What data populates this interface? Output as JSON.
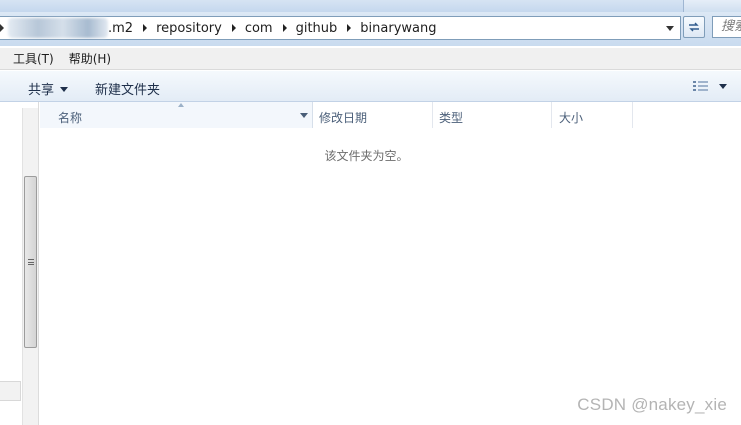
{
  "address_bar": {
    "crumbs": [
      ".m2",
      "repository",
      "com",
      "github",
      "binarywang"
    ]
  },
  "search": {
    "placeholder": "搜索"
  },
  "menu": {
    "items": [
      "工具(T)",
      "帮助(H)"
    ]
  },
  "toolbar": {
    "share_label": "共享",
    "new_folder_label": "新建文件夹"
  },
  "columns": {
    "name": "名称",
    "date_modified": "修改日期",
    "type": "类型",
    "size": "大小"
  },
  "empty_message": "该文件夹为空。",
  "watermark": "CSDN @nakey_xie",
  "icons": [
    "chevron-right-icon",
    "dropdown-arrow-icon",
    "refresh-icon",
    "view-options-icon",
    "scrollbar-grip-icon"
  ],
  "colors": {
    "address_border": "#7f9db9",
    "toolbar_text": "#1e2f4a",
    "header_text": "#4c607a",
    "chrome": "#c9dbef"
  }
}
